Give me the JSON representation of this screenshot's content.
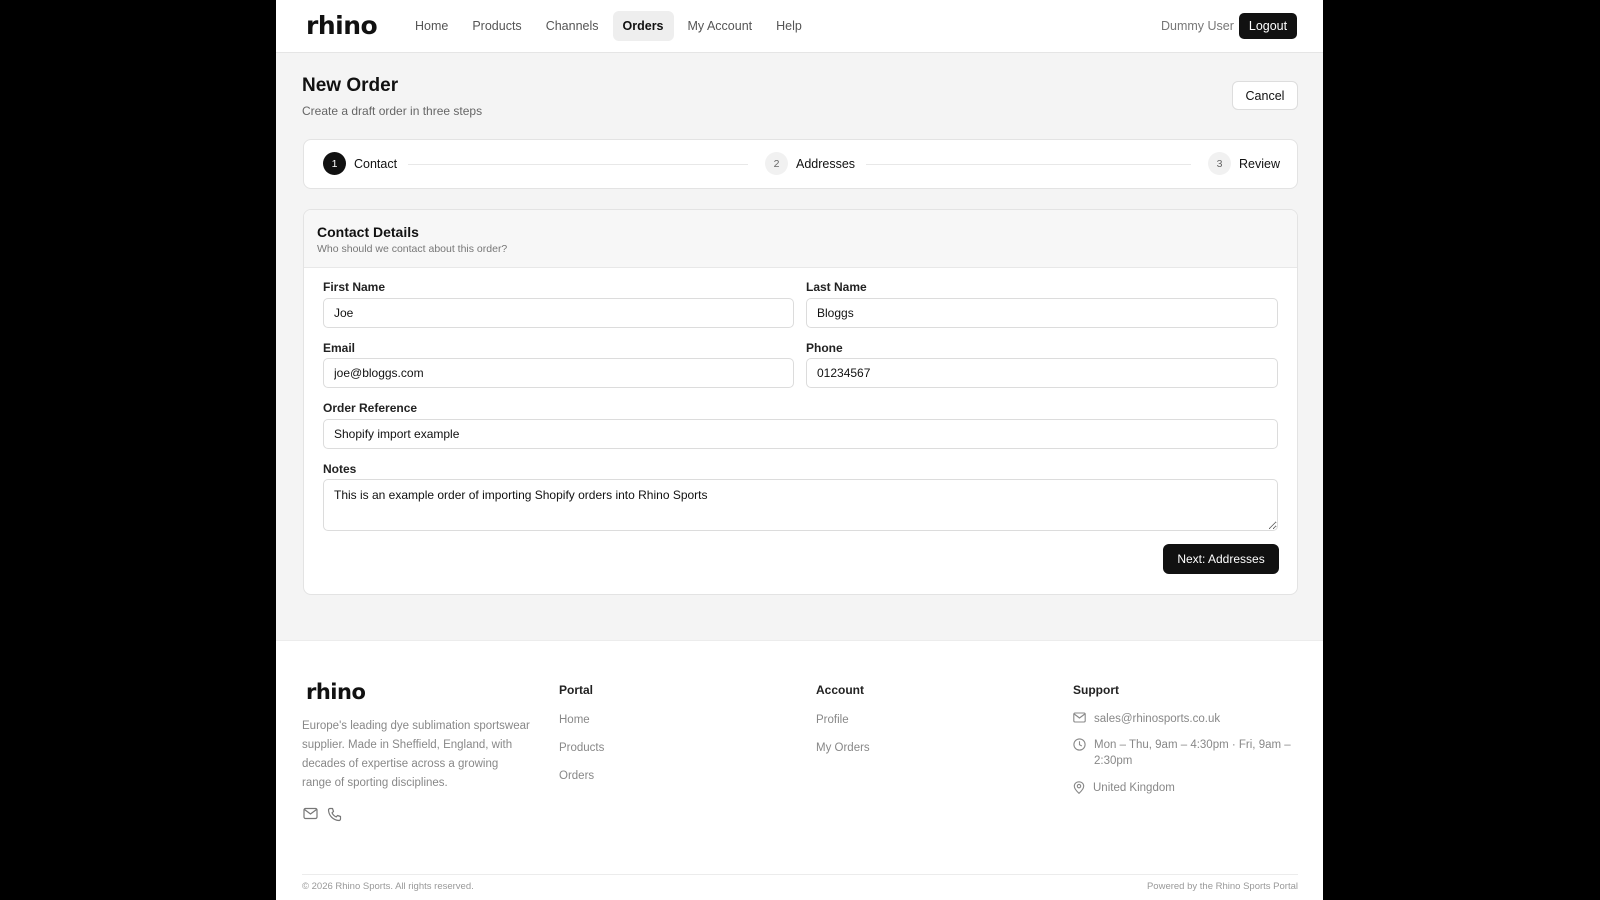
{
  "header": {
    "logo": "rhino",
    "nav": [
      "Home",
      "Products",
      "Channels",
      "Orders",
      "My Account",
      "Help"
    ],
    "user": "Dummy User",
    "logout": "Logout"
  },
  "page": {
    "title": "New Order",
    "subtitle": "Create a draft order in three steps",
    "cancel": "Cancel"
  },
  "stepper": {
    "steps": [
      {
        "num": "1",
        "label": "Contact"
      },
      {
        "num": "2",
        "label": "Addresses"
      },
      {
        "num": "3",
        "label": "Review"
      }
    ]
  },
  "form": {
    "title": "Contact Details",
    "subtitle": "Who should we contact about this order?",
    "first_name_label": "First Name",
    "first_name_value": "Joe",
    "last_name_label": "Last Name",
    "last_name_value": "Bloggs",
    "email_label": "Email",
    "email_value": "joe@bloggs.com",
    "phone_label": "Phone",
    "phone_value": "01234567",
    "reference_label": "Order Reference",
    "reference_value": "Shopify import example",
    "notes_label": "Notes",
    "notes_value": "This is an example order of importing Shopify orders into Rhino Sports",
    "next_button": "Next: Addresses"
  },
  "footer": {
    "logo": "rhino",
    "description": "Europe's leading dye sublimation sportswear supplier. Made in Sheffield, England, with decades of expertise across a growing range of sporting disciplines.",
    "portal_title": "Portal",
    "portal_links": [
      "Home",
      "Products",
      "Orders"
    ],
    "account_title": "Account",
    "account_links": [
      "Profile",
      "My Orders"
    ],
    "support_title": "Support",
    "support_email": "sales@rhinosports.co.uk",
    "support_hours": "Mon – Thu, 9am – 4:30pm · Fri, 9am – 2:30pm",
    "support_location": "United Kingdom",
    "copyright": "© 2026 Rhino Sports. All rights reserved.",
    "powered_by": "Powered by the Rhino Sports Portal"
  },
  "icons": {
    "mail": "mail-icon",
    "phone": "phone-icon",
    "clock": "clock-icon",
    "location": "map-pin-icon"
  },
  "colors": {
    "primary": "#111111",
    "background": "#f4f4f4",
    "muted_text": "#888888"
  }
}
